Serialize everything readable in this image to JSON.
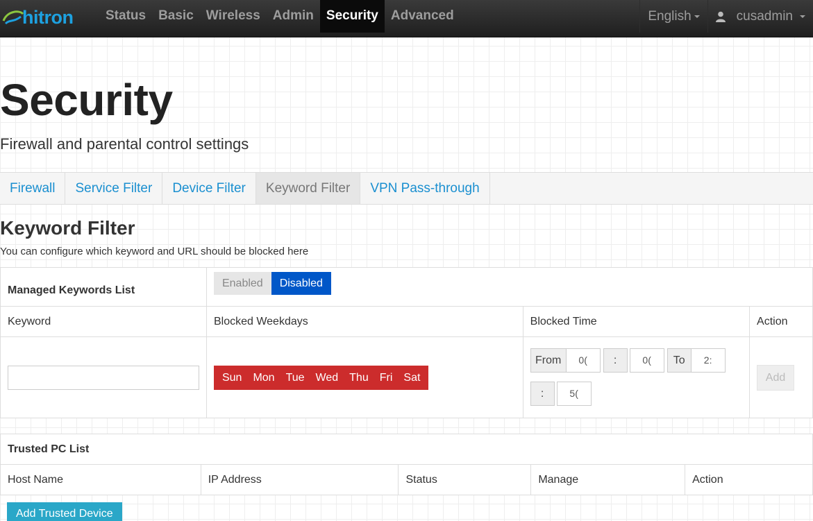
{
  "brand": {
    "logo_text": "hitron",
    "accent": "#1da1e0"
  },
  "nav": {
    "items": [
      {
        "label": "Status"
      },
      {
        "label": "Basic"
      },
      {
        "label": "Wireless"
      },
      {
        "label": "Admin"
      },
      {
        "label": "Security",
        "active": true
      },
      {
        "label": "Advanced"
      }
    ],
    "language": "English",
    "user": "cusadmin"
  },
  "header": {
    "title": "Security",
    "subtitle": "Firewall and parental control settings"
  },
  "tabs": [
    {
      "label": "Firewall"
    },
    {
      "label": "Service Filter"
    },
    {
      "label": "Device Filter"
    },
    {
      "label": "Keyword Filter",
      "active": true
    },
    {
      "label": "VPN Pass-through"
    }
  ],
  "section": {
    "title": "Keyword Filter",
    "description": "You can configure which keyword and URL should be blocked here"
  },
  "keyword_table": {
    "list_label": "Managed Keywords List",
    "toggle": {
      "enabled": "Enabled",
      "disabled": "Disabled",
      "selected": "Disabled",
      "color": "#0057c8"
    },
    "columns": [
      "Keyword",
      "Blocked Weekdays",
      "Blocked Time",
      "Action"
    ],
    "keyword_value": "",
    "weekdays": [
      "Sun",
      "Mon",
      "Tue",
      "Wed",
      "Thu",
      "Fri",
      "Sat"
    ],
    "weekday_color": "#cc2c2c",
    "time": {
      "from_label": "From",
      "from_hour": "0(",
      "from_sep": ":",
      "from_min": "0(",
      "to_label": "To",
      "to_hour": "2:",
      "to_sep": ":",
      "to_min": "5("
    },
    "add_label": "Add"
  },
  "trusted_table": {
    "title": "Trusted PC List",
    "columns": [
      "Host Name",
      "IP Address",
      "Status",
      "Manage",
      "Action"
    ],
    "add_button": "Add Trusted Device",
    "add_color": "#2aa7c8"
  }
}
